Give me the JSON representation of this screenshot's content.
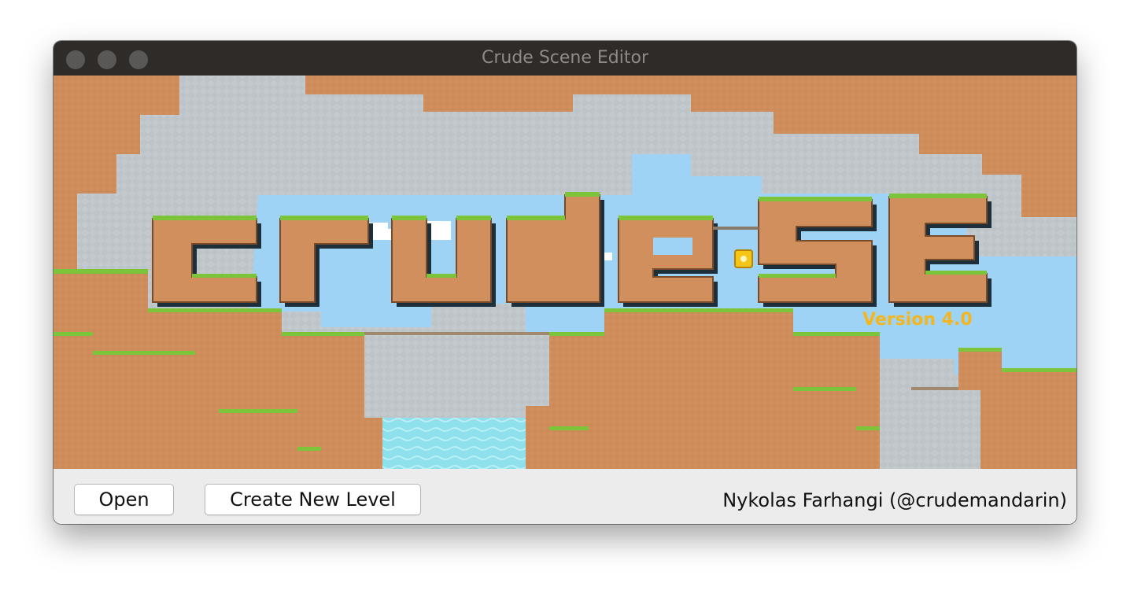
{
  "window": {
    "title": "Crude Scene Editor"
  },
  "splash": {
    "logo_text": "cruDeSE",
    "version": "Version 4.0"
  },
  "footer": {
    "open_label": "Open",
    "create_label": "Create New Level",
    "credit": "Nykolas Farhangi (@crudemandarin)"
  },
  "colors": {
    "titlebar": "#2e2b28",
    "dirt": "#d08f5d",
    "grass": "#7cc43a",
    "stone": "#c3c9cc",
    "sky": "#9fd3f5",
    "water": "#8ee0ec",
    "version": "#f3b61f"
  }
}
